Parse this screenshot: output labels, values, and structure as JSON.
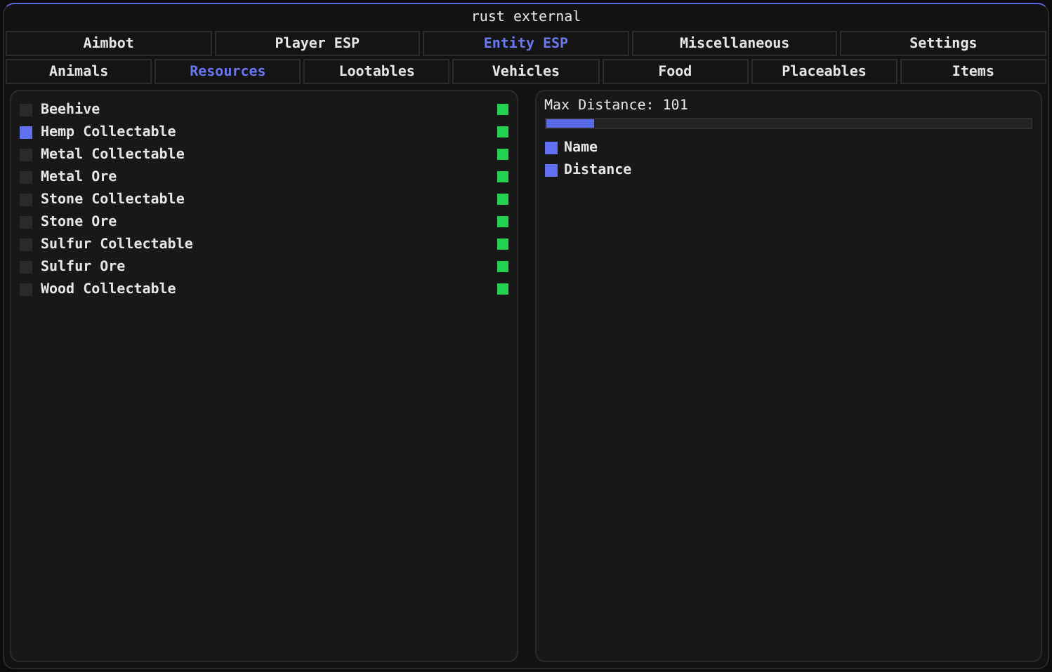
{
  "window": {
    "title": "rust external"
  },
  "tabs": [
    {
      "label": "Aimbot",
      "selected": false
    },
    {
      "label": "Player ESP",
      "selected": false
    },
    {
      "label": "Entity ESP",
      "selected": true
    },
    {
      "label": "Miscellaneous",
      "selected": false
    },
    {
      "label": "Settings",
      "selected": false
    }
  ],
  "subtabs": [
    {
      "label": "Animals",
      "selected": false
    },
    {
      "label": "Resources",
      "selected": true
    },
    {
      "label": "Lootables",
      "selected": false
    },
    {
      "label": "Vehicles",
      "selected": false
    },
    {
      "label": "Food",
      "selected": false
    },
    {
      "label": "Placeables",
      "selected": false
    },
    {
      "label": "Items",
      "selected": false
    }
  ],
  "resources": [
    {
      "label": "Beehive",
      "checked": false
    },
    {
      "label": "Hemp Collectable",
      "checked": true
    },
    {
      "label": "Metal Collectable",
      "checked": false
    },
    {
      "label": "Metal Ore",
      "checked": false
    },
    {
      "label": "Stone Collectable",
      "checked": false
    },
    {
      "label": "Stone Ore",
      "checked": false
    },
    {
      "label": "Sulfur Collectable",
      "checked": false
    },
    {
      "label": "Sulfur Ore",
      "checked": false
    },
    {
      "label": "Wood Collectable",
      "checked": false
    }
  ],
  "settings": {
    "slider": {
      "label": "Max Distance: 101",
      "level": 0.1
    },
    "options": [
      {
        "label": "Name",
        "checked": true
      },
      {
        "label": "Distance",
        "checked": true
      }
    ]
  }
}
